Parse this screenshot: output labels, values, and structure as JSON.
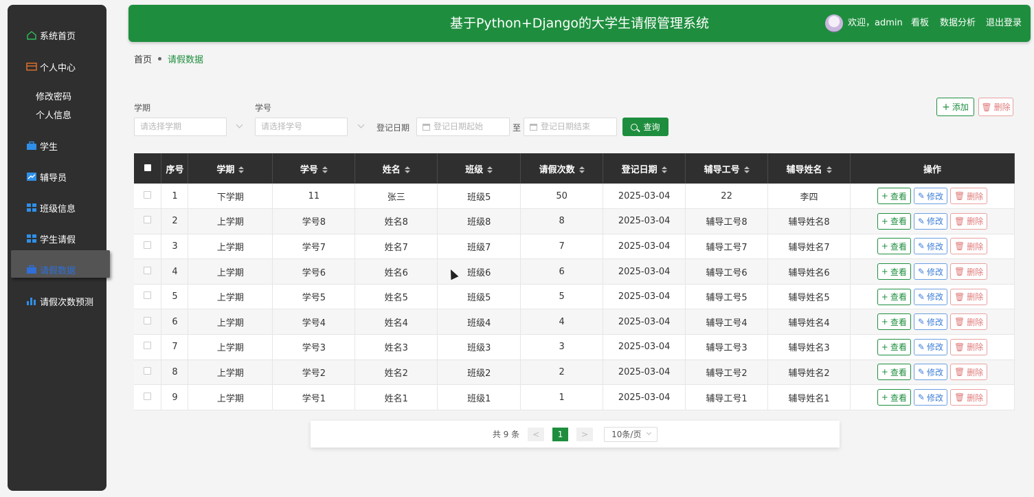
{
  "app": {
    "title": "基于Python+Django的大学生请假管理系统",
    "welcome": "欢迎，admin",
    "links": [
      "看板",
      "数据分析",
      "退出登录"
    ],
    "accent": "#1e8e3e"
  },
  "sidebar": {
    "items": [
      {
        "label": "系统首页",
        "icon": "home-icon"
      },
      {
        "label": "个人中心",
        "icon": "card-icon"
      },
      {
        "label": "学生",
        "icon": "briefcase-icon"
      },
      {
        "label": "辅导员",
        "icon": "chart-line-icon"
      },
      {
        "label": "班级信息",
        "icon": "grid-icon"
      },
      {
        "label": "学生请假",
        "icon": "grid-icon"
      },
      {
        "label": "请假数据",
        "icon": "briefcase-icon"
      },
      {
        "label": "请假次数预测",
        "icon": "bar-chart-icon"
      }
    ],
    "subitems": [
      "修改密码",
      "个人信息"
    ],
    "active": "请假数据"
  },
  "breadcrumb": {
    "home": "首页",
    "current": "请假数据"
  },
  "search": {
    "term_label": "学期",
    "term_placeholder": "请选择学期",
    "sid_label": "学号",
    "sid_placeholder": "请选择学号",
    "date_label": "登记日期",
    "date_start_placeholder": "登记日期起始",
    "date_to": "至",
    "date_end_placeholder": "登记日期结束",
    "query_button": "查询"
  },
  "actions": {
    "add": "添加",
    "delete": "删除"
  },
  "table": {
    "columns": [
      "序号",
      "学期",
      "学号",
      "姓名",
      "班级",
      "请假次数",
      "登记日期",
      "辅导工号",
      "辅导姓名",
      "操作"
    ],
    "rows": [
      [
        "1",
        "下学期",
        "11",
        "张三",
        "班级5",
        "50",
        "2025-03-04",
        "22",
        "李四"
      ],
      [
        "2",
        "上学期",
        "学号8",
        "姓名8",
        "班级8",
        "8",
        "2025-03-04",
        "辅导工号8",
        "辅导姓名8"
      ],
      [
        "3",
        "上学期",
        "学号7",
        "姓名7",
        "班级7",
        "7",
        "2025-03-04",
        "辅导工号7",
        "辅导姓名7"
      ],
      [
        "4",
        "上学期",
        "学号6",
        "姓名6",
        "班级6",
        "6",
        "2025-03-04",
        "辅导工号6",
        "辅导姓名6"
      ],
      [
        "5",
        "上学期",
        "学号5",
        "姓名5",
        "班级5",
        "5",
        "2025-03-04",
        "辅导工号5",
        "辅导姓名5"
      ],
      [
        "6",
        "上学期",
        "学号4",
        "姓名4",
        "班级4",
        "4",
        "2025-03-04",
        "辅导工号4",
        "辅导姓名4"
      ],
      [
        "7",
        "上学期",
        "学号3",
        "姓名3",
        "班级3",
        "3",
        "2025-03-04",
        "辅导工号3",
        "辅导姓名3"
      ],
      [
        "8",
        "上学期",
        "学号2",
        "姓名2",
        "班级2",
        "2",
        "2025-03-04",
        "辅导工号2",
        "辅导姓名2"
      ],
      [
        "9",
        "上学期",
        "学号1",
        "姓名1",
        "班级1",
        "1",
        "2025-03-04",
        "辅导工号1",
        "辅导姓名1"
      ]
    ],
    "row_actions": [
      "查看",
      "修改",
      "删除"
    ]
  },
  "pagination": {
    "total": "共 9 条",
    "prev": "<",
    "page": "1",
    "next": ">",
    "page_size": "10条/页"
  }
}
